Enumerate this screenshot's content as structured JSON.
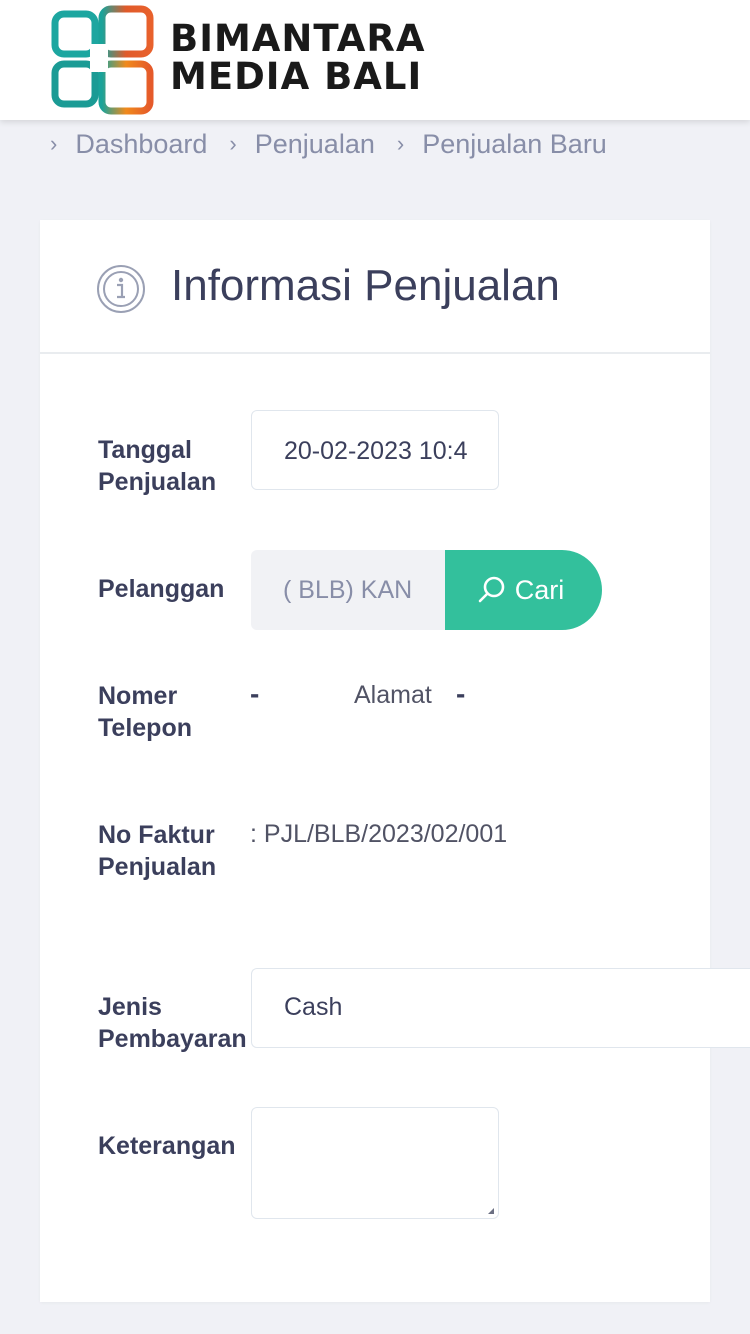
{
  "brand": {
    "line1": "BIMANTARA",
    "line2": "MEDIA BALI",
    "colors": [
      "#e8612c",
      "#f7a21b",
      "#1da6a0",
      "#2e8b57"
    ]
  },
  "breadcrumb": {
    "items": [
      "Dashboard",
      "Penjualan",
      "Penjualan Baru"
    ]
  },
  "card": {
    "title": "Informasi Penjualan",
    "icon": "info-circle-icon"
  },
  "form": {
    "tanggal_label": "Tanggal Penjualan",
    "tanggal_value": "20-02-2023 10:4",
    "pelanggan_label": "Pelanggan",
    "pelanggan_value": "( BLB) KAN",
    "cari_label": "Cari",
    "telepon_label": "Nomer Telepon",
    "telepon_value": "-",
    "alamat_label": "Alamat",
    "alamat_value": "-",
    "faktur_label": "No Faktur Penjualan",
    "faktur_value": ": PJL/BLB/2023/02/001",
    "pembayaran_label": "Jenis Pembayaran",
    "pembayaran_value": "Cash",
    "keterangan_label": "Keterangan",
    "keterangan_value": ""
  },
  "colors": {
    "accent": "#33c09c",
    "background": "#f0f1f6",
    "text": "#3b3f5c"
  }
}
